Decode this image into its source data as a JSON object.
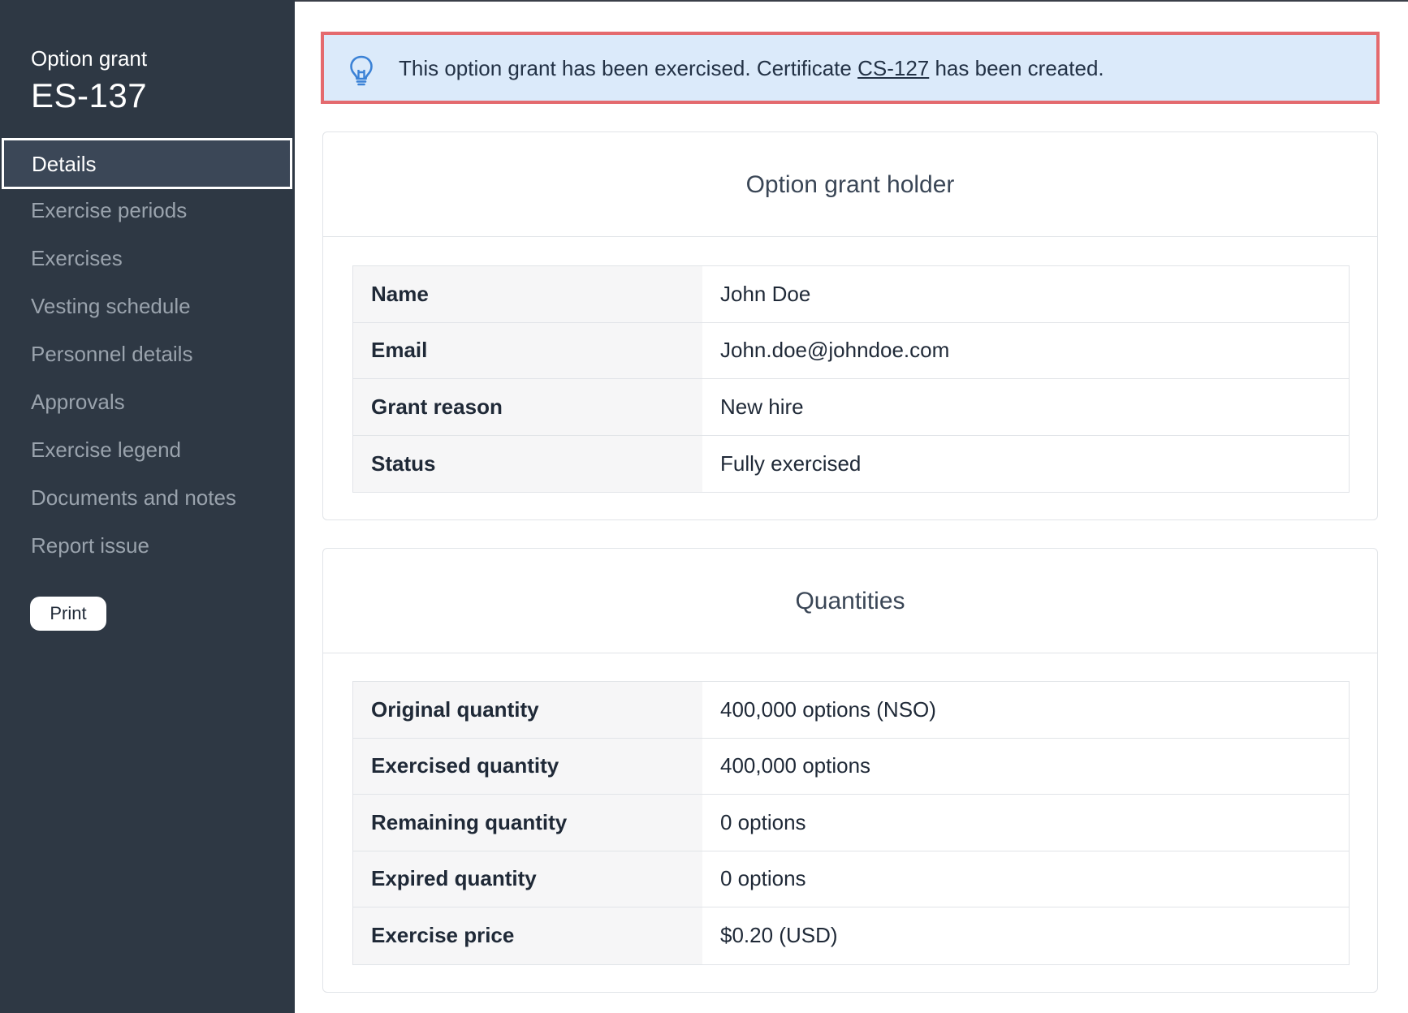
{
  "sidebar": {
    "subtitle": "Option grant",
    "title": "ES-137",
    "items": [
      {
        "label": "Details",
        "active": true
      },
      {
        "label": "Exercise periods"
      },
      {
        "label": "Exercises"
      },
      {
        "label": "Vesting schedule"
      },
      {
        "label": "Personnel details"
      },
      {
        "label": "Approvals"
      },
      {
        "label": "Exercise legend"
      },
      {
        "label": "Documents and notes"
      },
      {
        "label": "Report issue"
      }
    ],
    "print_label": "Print"
  },
  "banner": {
    "icon": "lightbulb-icon",
    "text_before": "This option grant has been exercised. Certificate ",
    "link": "CS-127",
    "text_after": " has been created."
  },
  "holder": {
    "title": "Option grant holder",
    "rows": [
      {
        "label": "Name",
        "value": "John Doe"
      },
      {
        "label": "Email",
        "value": "John.doe@johndoe.com"
      },
      {
        "label": "Grant reason",
        "value": "New hire"
      },
      {
        "label": "Status",
        "value": "Fully exercised"
      }
    ]
  },
  "quantities": {
    "title": "Quantities",
    "rows": [
      {
        "label": "Original quantity",
        "value": "400,000 options (NSO)"
      },
      {
        "label": "Exercised quantity",
        "value": "400,000 options"
      },
      {
        "label": "Remaining quantity",
        "value": "0 options"
      },
      {
        "label": "Expired quantity",
        "value": "0 options"
      },
      {
        "label": "Exercise price",
        "value": "$0.20 (USD)"
      }
    ]
  },
  "colors": {
    "sidebar_bg": "#2e3844",
    "banner_bg": "#dbeafa",
    "banner_border": "#e46a6e"
  }
}
